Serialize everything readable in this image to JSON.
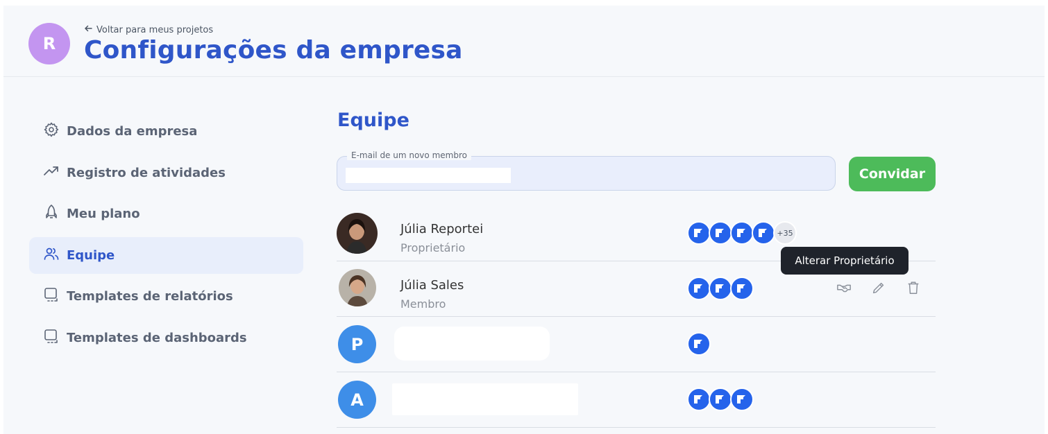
{
  "header": {
    "company_initial": "R",
    "back_link": "Voltar para meus projetos",
    "title": "Configurações da empresa"
  },
  "sidebar": {
    "items": [
      {
        "label": "Dados da empresa",
        "icon": "gear-icon"
      },
      {
        "label": "Registro de atividades",
        "icon": "trend-icon"
      },
      {
        "label": "Meu plano",
        "icon": "rocket-icon"
      },
      {
        "label": "Equipe",
        "icon": "users-icon",
        "active": true
      },
      {
        "label": "Templates de relatórios",
        "icon": "template-icon"
      },
      {
        "label": "Templates de dashboards",
        "icon": "template-icon"
      }
    ]
  },
  "team": {
    "title": "Equipe",
    "invite_label": "E-mail de um novo membro",
    "invite_value": "",
    "invite_button": "Convidar",
    "tooltip": "Alterar Proprietário",
    "members": [
      {
        "name": "Júlia Reportei",
        "role": "Proprietário",
        "projects": 4,
        "more": "+35"
      },
      {
        "name": "Júlia Sales",
        "role": "Membro",
        "projects": 3
      },
      {
        "initial": "P",
        "name": "",
        "role": "",
        "projects": 1
      },
      {
        "initial": "A",
        "name": "",
        "role": "",
        "projects": 3
      }
    ]
  },
  "colors": {
    "brand": "#2f56c9",
    "invite_button": "#4dbb5a",
    "project_icon": "#2563eb",
    "company_avatar": "#c395f0",
    "letter_avatar": "#3e8ee8"
  }
}
